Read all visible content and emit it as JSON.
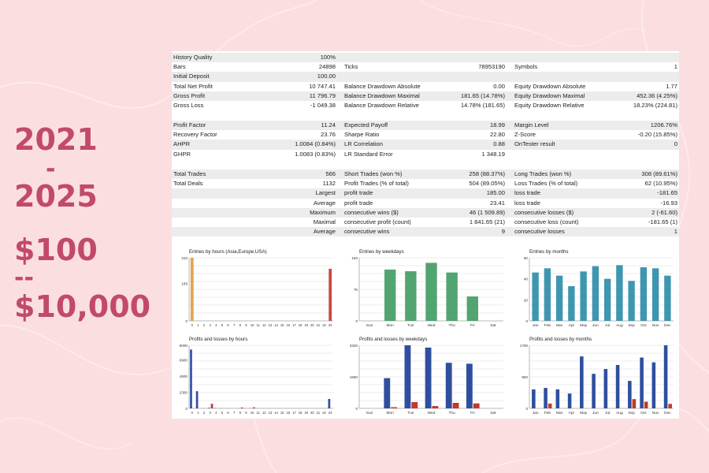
{
  "promo": {
    "line1": "2021",
    "dash": "-",
    "line2": "2025",
    "amount_from": "$100",
    "arrow": "--",
    "amount_to": "$10,000"
  },
  "report": {
    "section1": [
      [
        {
          "label": "History Quality",
          "value": "100%"
        }
      ],
      [
        {
          "label": "Bars",
          "value": "24898"
        },
        {
          "label": "Ticks",
          "value": "78953190"
        },
        {
          "label": "Symbols",
          "value": "1"
        }
      ],
      [
        {
          "label": "Initial Deposit",
          "value": "100.00"
        }
      ],
      [
        {
          "label": "Total Net Profit",
          "value": "10 747.41"
        },
        {
          "label": "Balance Drawdown Absolute",
          "value": "0.00"
        },
        {
          "label": "Equity Drawdown Absolute",
          "value": "1.77"
        }
      ],
      [
        {
          "label": "Gross Profit",
          "value": "11 796.79"
        },
        {
          "label": "Balance Drawdown Maximal",
          "value": "181.65 (14.78%)"
        },
        {
          "label": "Equity Drawdown Maximal",
          "value": "452.36 (4.25%)"
        }
      ],
      [
        {
          "label": "Gross Loss",
          "value": "-1 049.38"
        },
        {
          "label": "Balance Drawdown Relative",
          "value": "14.78% (181.65)"
        },
        {
          "label": "Equity Drawdown Relative",
          "value": "18.23% (224.81)"
        }
      ]
    ],
    "section2": [
      [
        {
          "label": "Profit Factor",
          "value": "11.24"
        },
        {
          "label": "Expected Payoff",
          "value": "18.99"
        },
        {
          "label": "Margin Level",
          "value": "1206.76%"
        }
      ],
      [
        {
          "label": "Recovery Factor",
          "value": "23.76"
        },
        {
          "label": "Sharpe Ratio",
          "value": "22.80"
        },
        {
          "label": "Z-Score",
          "value": "-0.20 (15.85%)"
        }
      ],
      [
        {
          "label": "AHPR",
          "value": "1.0084 (0.84%)"
        },
        {
          "label": "LR Correlation",
          "value": "0.88"
        },
        {
          "label": "OnTester result",
          "value": "0"
        }
      ],
      [
        {
          "label": "GHPR",
          "value": "1.0083 (0.83%)"
        },
        {
          "label": "LR Standard Error",
          "value": "1 348.19"
        }
      ]
    ],
    "section3": [
      [
        {
          "label": "Total Trades",
          "value": "566"
        },
        {
          "label": "Short Trades (won %)",
          "value": "258 (88.37%)"
        },
        {
          "label": "Long Trades (won %)",
          "value": "308 (89.61%)"
        }
      ],
      [
        {
          "label": "Total Deals",
          "value": "1132"
        },
        {
          "label": "Profit Trades (% of total)",
          "value": "504 (89.05%)"
        },
        {
          "label": "Loss Trades (% of total)",
          "value": "62 (10.95%)"
        }
      ],
      [
        {
          "label": "",
          "value": "Largest"
        },
        {
          "label": "profit trade",
          "value": "185.00"
        },
        {
          "label": "loss trade",
          "value": "-181.65"
        }
      ],
      [
        {
          "label": "",
          "value": "Average"
        },
        {
          "label": "profit trade",
          "value": "23.41"
        },
        {
          "label": "loss trade",
          "value": "-16.93"
        }
      ],
      [
        {
          "label": "",
          "value": "Maximum"
        },
        {
          "label": "consecutive wins ($)",
          "value": "46 (1 509.89)"
        },
        {
          "label": "consecutive losses ($)",
          "value": "2 (-61.60)"
        }
      ],
      [
        {
          "label": "",
          "value": "Maximal"
        },
        {
          "label": "consecutive profit (count)",
          "value": "1 841.65 (21)"
        },
        {
          "label": "consecutive loss (count)",
          "value": "-181.65 (1)"
        }
      ],
      [
        {
          "label": "",
          "value": "Average"
        },
        {
          "label": "consecutive wins",
          "value": "9"
        },
        {
          "label": "consecutive losses",
          "value": "1"
        }
      ]
    ]
  },
  "chart_data": [
    {
      "type": "bar",
      "title": "Entries by hours (Asia,Europe,USA)",
      "categories": [
        "0",
        "1",
        "2",
        "3",
        "4",
        "5",
        "6",
        "7",
        "8",
        "9",
        "10",
        "11",
        "12",
        "13",
        "14",
        "15",
        "16",
        "17",
        "18",
        "19",
        "20",
        "21",
        "22",
        "23"
      ],
      "yticks": [
        "0",
        "185",
        "310"
      ],
      "ymax": 310,
      "values": [
        310,
        0,
        0,
        0,
        0,
        0,
        0,
        0,
        0,
        0,
        0,
        0,
        0,
        0,
        0,
        0,
        0,
        0,
        0,
        0,
        0,
        0,
        0,
        256
      ],
      "color": "#e09a3c",
      "color_end": "#c0392b"
    },
    {
      "type": "bar",
      "title": "Entries by weekdays",
      "categories": [
        "Sun",
        "Mon",
        "Tue",
        "Wed",
        "Thu",
        "Fri",
        "Sat"
      ],
      "yticks": [
        "0",
        "75",
        "150"
      ],
      "ymax": 150,
      "values": [
        0,
        122,
        118,
        138,
        115,
        58,
        0
      ],
      "color": "#3f9a62"
    },
    {
      "type": "bar",
      "title": "Entries by months",
      "categories": [
        "Jan",
        "Feb",
        "Mar",
        "Apr",
        "May",
        "Jun",
        "Jul",
        "Aug",
        "Sep",
        "Oct",
        "Nov",
        "Dec"
      ],
      "yticks": [
        "0",
        "20",
        "40",
        "60"
      ],
      "ymax": 60,
      "values": [
        46,
        50,
        43,
        33,
        47,
        52,
        40,
        53,
        38,
        51,
        50,
        43
      ],
      "color": "#2a8ba8"
    },
    {
      "type": "bar",
      "title": "Profits and losses by hours",
      "categories": [
        "0",
        "1",
        "2",
        "3",
        "4",
        "5",
        "6",
        "7",
        "8",
        "9",
        "10",
        "11",
        "12",
        "13",
        "14",
        "15",
        "16",
        "17",
        "18",
        "19",
        "20",
        "21",
        "22",
        "23"
      ],
      "yticks": [
        "0",
        "2300",
        "4600",
        "6900",
        "9000"
      ],
      "ymax": 9000,
      "series": [
        {
          "name": "profit",
          "values": [
            8400,
            2450,
            20,
            80,
            40,
            30,
            20,
            10,
            20,
            20,
            30,
            10,
            10,
            20,
            10,
            10,
            10,
            10,
            10,
            10,
            10,
            10,
            10,
            1350
          ]
        },
        {
          "name": "loss",
          "values": [
            0,
            0,
            0,
            650,
            0,
            0,
            0,
            0,
            120,
            0,
            150,
            0,
            0,
            0,
            0,
            0,
            0,
            0,
            0,
            0,
            0,
            0,
            0,
            0
          ]
        }
      ],
      "colors": [
        "#2f4f9e",
        "#c0392b"
      ]
    },
    {
      "type": "bar",
      "title": "Profits and losses by weekdays",
      "categories": [
        "Sun",
        "Mon",
        "Tue",
        "Wed",
        "Thu",
        "Fri",
        "Sat"
      ],
      "yticks": [
        "0",
        "1660",
        "3320"
      ],
      "ymax": 3320,
      "series": [
        {
          "name": "profit",
          "values": [
            0,
            1590,
            3320,
            3200,
            2400,
            2350,
            0
          ]
        },
        {
          "name": "loss",
          "values": [
            0,
            60,
            330,
            120,
            290,
            260,
            0
          ]
        }
      ],
      "colors": [
        "#2f4f9e",
        "#c0392b"
      ]
    },
    {
      "type": "bar",
      "title": "Profits and losses by months",
      "categories": [
        "Jan",
        "Feb",
        "Mar",
        "Apr",
        "May",
        "Jun",
        "Jul",
        "Aug",
        "Sep",
        "Oct",
        "Nov",
        "Dec"
      ],
      "yticks": [
        "0",
        "850",
        "1700"
      ],
      "ymax": 1700,
      "series": [
        {
          "name": "profit",
          "values": [
            510,
            550,
            510,
            400,
            1400,
            930,
            1060,
            1170,
            740,
            1370,
            1240,
            1700
          ]
        },
        {
          "name": "loss",
          "values": [
            0,
            130,
            0,
            0,
            0,
            0,
            0,
            0,
            250,
            180,
            0,
            120
          ]
        }
      ],
      "colors": [
        "#2f4f9e",
        "#c0392b"
      ]
    }
  ]
}
